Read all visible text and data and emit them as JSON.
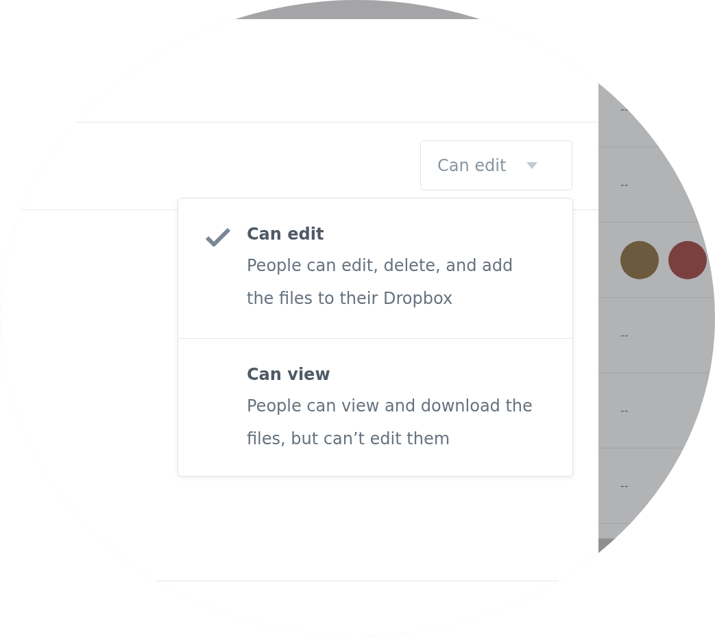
{
  "permission_select": {
    "value": "Can edit"
  },
  "menu": {
    "options": [
      {
        "title": "Can edit",
        "description": "People can edit, delete, and add the files to their Dropbox",
        "selected": true
      },
      {
        "title": "Can view",
        "description": "People can view and download the files, but can’t edit them",
        "selected": false
      }
    ]
  },
  "side_rows": [
    {
      "kind": "text",
      "text": "--"
    },
    {
      "kind": "text",
      "text": "--"
    },
    {
      "kind": "avatars"
    },
    {
      "kind": "text",
      "text": "--"
    },
    {
      "kind": "text",
      "text": "--"
    },
    {
      "kind": "text",
      "text": "--"
    }
  ]
}
